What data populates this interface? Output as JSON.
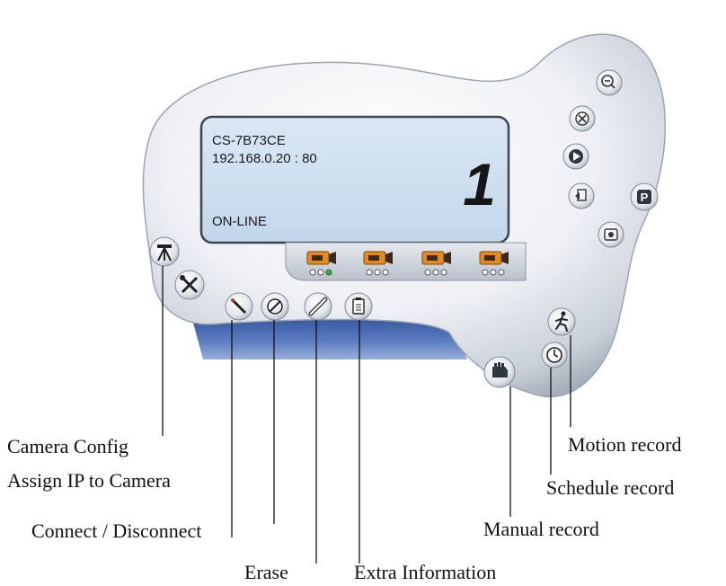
{
  "lcd": {
    "camera_id": "CS-7B73CE",
    "address": "192.168.0.20 : 80",
    "channel": "1",
    "status": "ON-LINE"
  },
  "camera_slots": [
    {
      "selected_indicator": 3
    },
    {
      "selected_indicator": 0
    },
    {
      "selected_indicator": 0
    },
    {
      "selected_indicator": 0
    }
  ],
  "buttons": {
    "zoom_out": "zoom-out-icon",
    "close": "close-icon",
    "play": "play-icon",
    "config_export": "export-icon",
    "snapshot": "snapshot-icon",
    "parking": "parking-icon",
    "camera_config": "tripod-icon",
    "tools": "tools-icon",
    "assign_ip": "pen-icon",
    "connect": "compass-icon",
    "erase": "eraser-icon",
    "extra_info": "clipboard-icon",
    "motion_record": "runner-icon",
    "schedule_record": "clock-icon",
    "manual_record": "hand-icon"
  },
  "callouts": {
    "camera_config": "Camera Config",
    "assign_ip": "Assign IP to Camera",
    "connect": "Connect / Disconnect",
    "erase": "Erase",
    "extra_info": "Extra Information",
    "motion_record": "Motion record",
    "schedule_record": "Schedule record",
    "manual_record": "Manual record"
  },
  "colors": {
    "body_light": "#f2f4f7",
    "body_shadow": "#aab4c0",
    "lcd_bg": "#cfe1f3",
    "base_blue": "#3c5fa6",
    "cam_orange": "#e58a1f",
    "indicator_on": "#36b04a"
  }
}
